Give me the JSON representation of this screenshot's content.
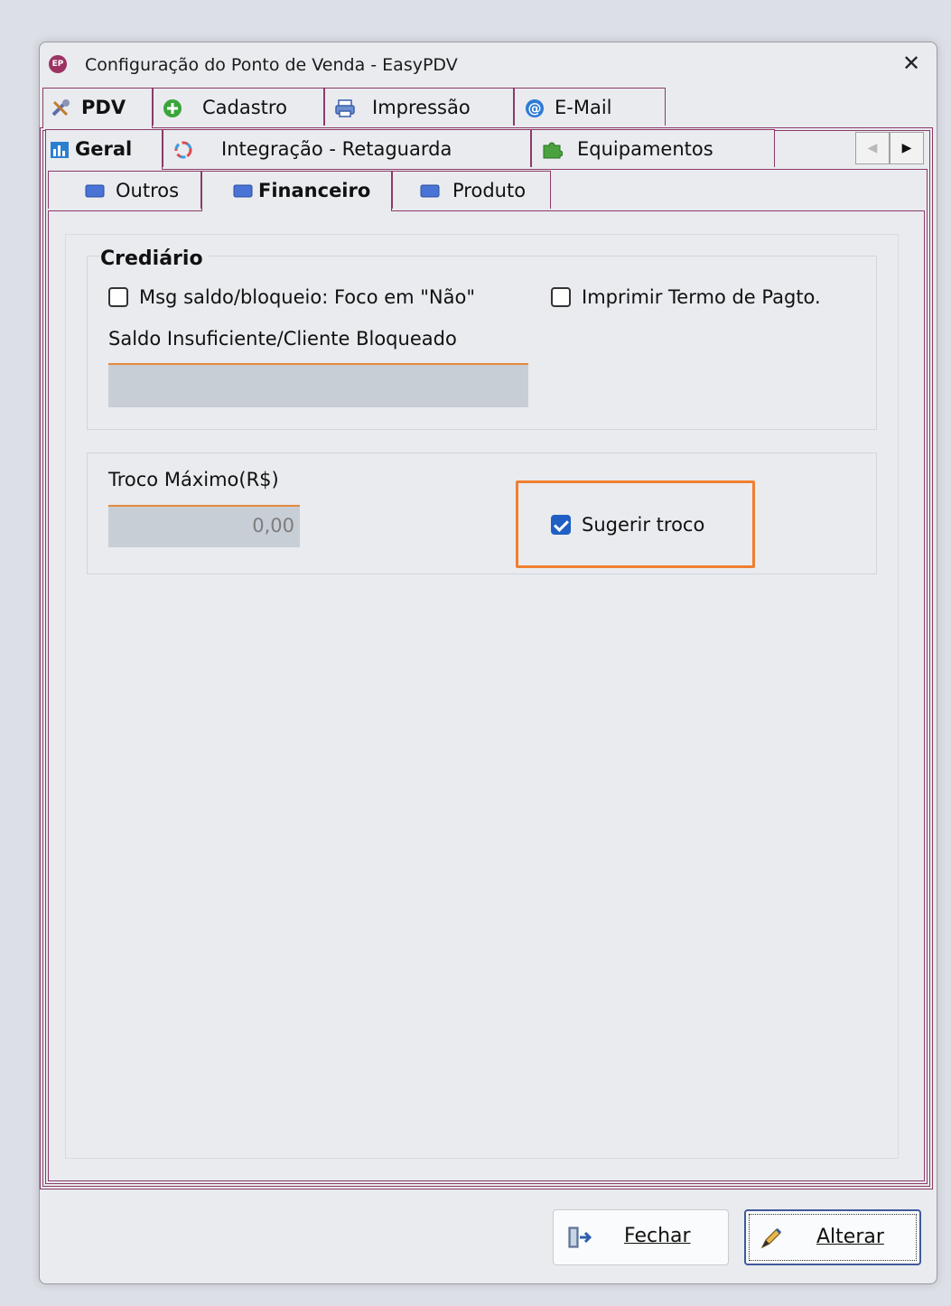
{
  "window": {
    "title": "Configuração do Ponto de Venda - EasyPDV",
    "app_icon_text": "EP"
  },
  "tabs_row1": [
    {
      "label": "PDV",
      "icon": "tools-icon",
      "active": true
    },
    {
      "label": "Cadastro",
      "icon": "plus-circle-icon"
    },
    {
      "label": "Impressão",
      "icon": "printer-icon"
    },
    {
      "label": "E-Mail",
      "icon": "at-icon"
    }
  ],
  "tabs_row2": [
    {
      "label": "Geral",
      "icon": "grid-icon",
      "active": true
    },
    {
      "label": "Integração - Retaguarda",
      "icon": "sync-icon"
    },
    {
      "label": "Equipamentos",
      "icon": "puzzle-icon"
    }
  ],
  "tabs_row3": [
    {
      "label": "Outros",
      "icon": "folder-icon"
    },
    {
      "label": "Financeiro",
      "icon": "folder-icon",
      "active": true
    },
    {
      "label": "Produto",
      "icon": "folder-icon"
    }
  ],
  "crediario": {
    "title": "Crediário",
    "msg_saldo_label": "Msg saldo/bloqueio: Foco em \"Não\"",
    "msg_saldo_checked": false,
    "imprimir_termo_label": "Imprimir Termo de Pagto.",
    "imprimir_termo_checked": false,
    "saldo_label": "Saldo Insuficiente/Cliente Bloqueado",
    "saldo_value": ""
  },
  "troco": {
    "label": "Troco Máximo(R$)",
    "value": "0,00",
    "sugerir_label": "Sugerir troco",
    "sugerir_checked": true
  },
  "buttons": {
    "fechar": "Fechar",
    "alterar": "Alterar"
  },
  "colors": {
    "tab_border": "#8c3a68",
    "highlight": "#f07f30",
    "check_accent": "#1f5fc4"
  }
}
